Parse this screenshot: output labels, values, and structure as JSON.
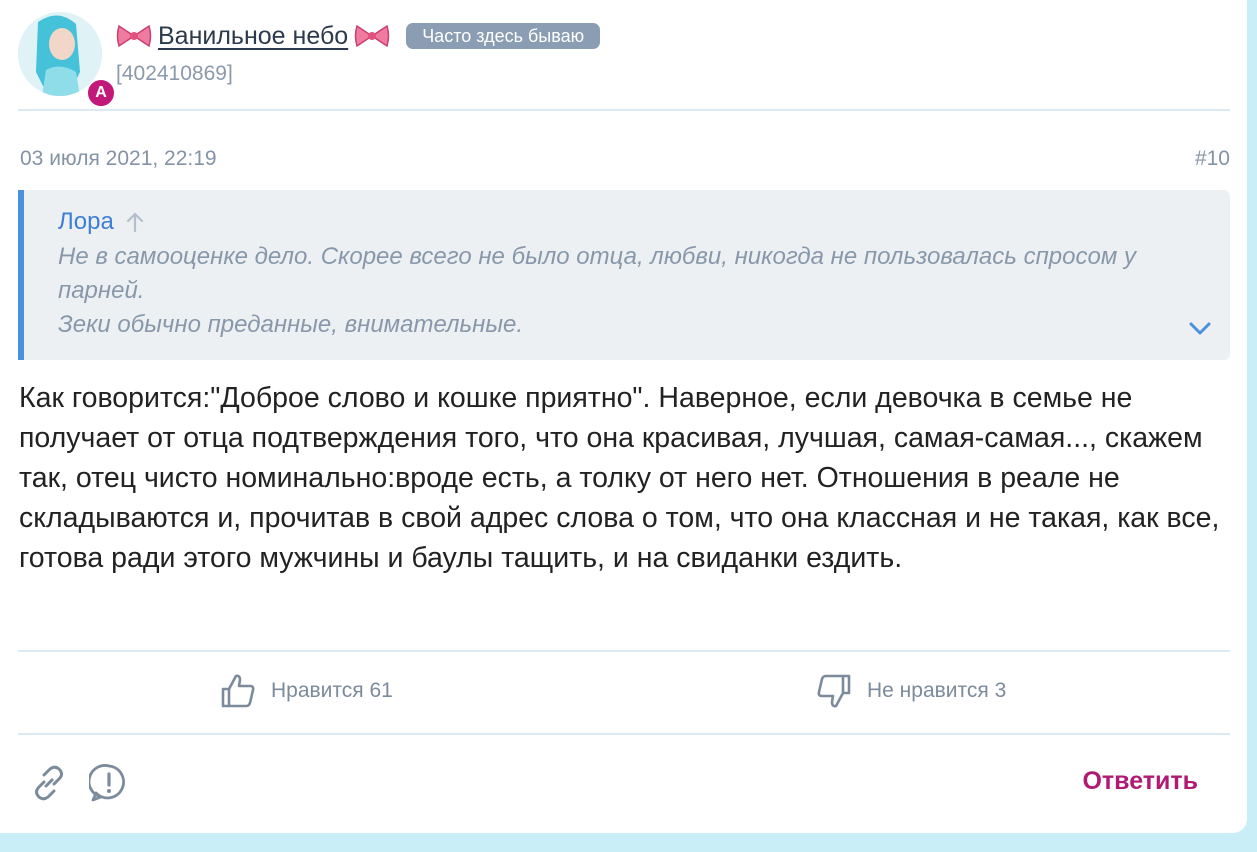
{
  "author": {
    "avatar_badge": "А",
    "name": "Ванильное небо",
    "name_emoji": "🎀",
    "status": "Часто здесь бываю",
    "id": "[402410869]"
  },
  "post": {
    "date": "03 июля 2021, 22:19",
    "number": "#10",
    "quote": {
      "author": "Лора",
      "lines": [
        "Не в самооценке дело. Скорее всего не было отца, любви, никогда не пользовалась спросом у парней.",
        "Зеки обычно преданные, внимательные."
      ]
    },
    "body": "Как говорится:\"Доброе слово и кошке приятно\". Наверное, если девочка в семье не получает от отца подтверждения того, что она красивая, лучшая, самая-самая..., скажем так, отец чисто номинально:вроде есть, а толку от него нет. Отношения в реале не складываются и, прочитав в свой адрес слова о том, что она классная и не такая, как все, готова ради этого мужчины и баулы тащить, и на свиданки ездить."
  },
  "votes": {
    "like_label": "Нравится 61",
    "dislike_label": "Не нравится 3"
  },
  "actions": {
    "reply_label": "Ответить"
  },
  "colors": {
    "accent": "#b01a73",
    "quote_border": "#4a8fe0",
    "page_bg": "#c9eef7"
  }
}
